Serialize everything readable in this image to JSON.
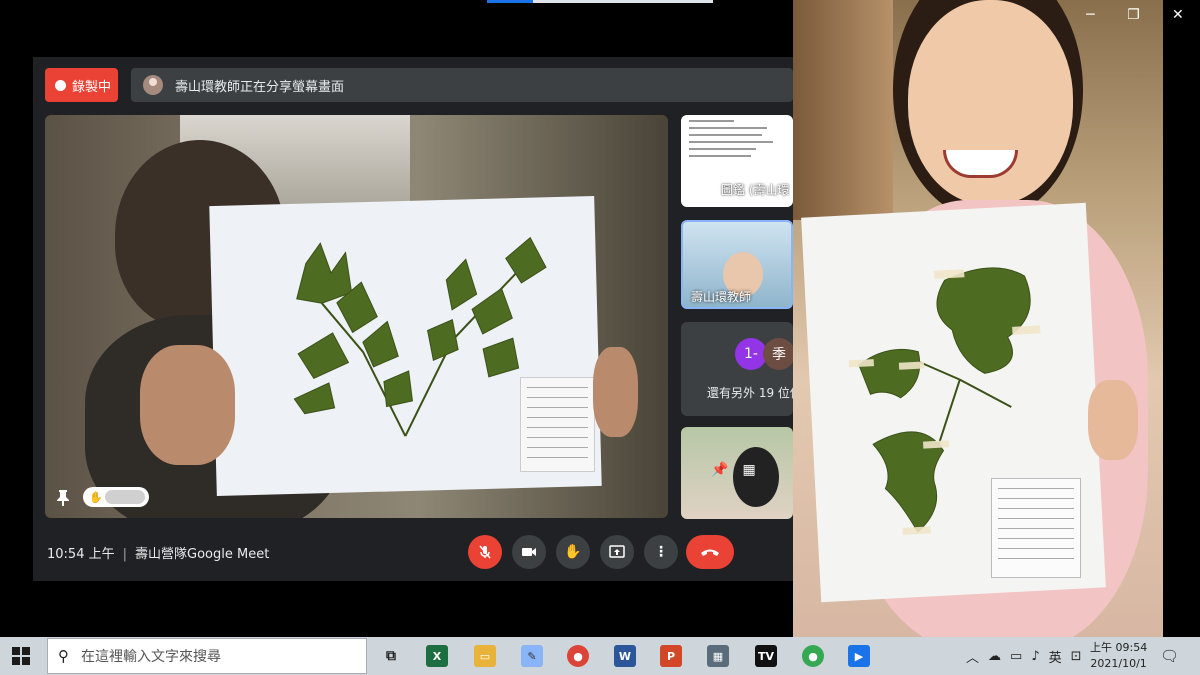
{
  "meet": {
    "recording_label": "錄製中",
    "share_banner": "壽山環教師正在分享螢幕畫面",
    "time": "10:54 上午",
    "meeting_name": "壽山營隊Google Meet",
    "tiles": {
      "doc_caption": "圖鑑 (壽山環",
      "teacher_caption": "壽山環教師",
      "avatar_1": "1-",
      "avatar_2": "季",
      "others_text": "還有另外 19 位使"
    }
  },
  "icons": {
    "record": "record-dot-icon",
    "pin": "pin-icon",
    "hand": "raise-hand-icon",
    "mic": "mic-off-icon",
    "camera": "camera-icon",
    "present": "present-screen-icon",
    "more": "more-vert-icon",
    "hangup": "hang-up-icon"
  },
  "colors": {
    "meet_bg": "#202124",
    "rec_red": "#ea4335",
    "taskbar": "#ced6dc"
  },
  "taskbar": {
    "search_placeholder": "在這裡輸入文字來搜尋",
    "ime": "英",
    "clock_time": "上午 09:54",
    "clock_date": "2021/10/1"
  }
}
